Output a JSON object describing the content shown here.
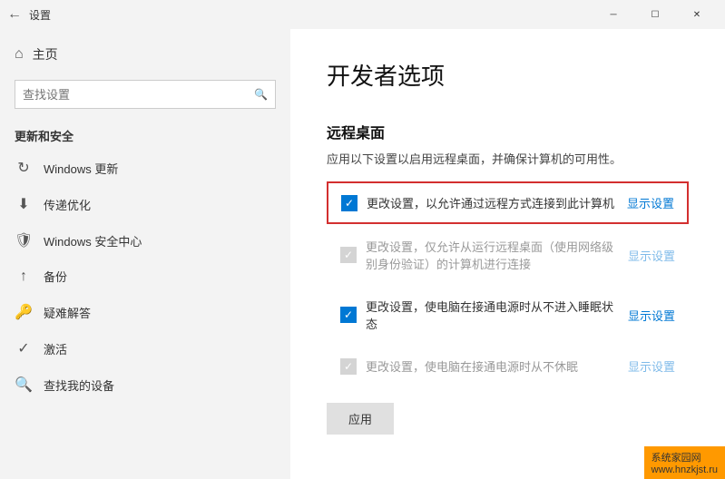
{
  "titlebar": {
    "title": "设置",
    "minimize": "─",
    "maximize": "☐",
    "close": "✕"
  },
  "sidebar": {
    "home_label": "主页",
    "search_placeholder": "查找设置",
    "section_title": "更新和安全",
    "items": [
      {
        "id": "windows-update",
        "label": "Windows 更新",
        "icon": "↻"
      },
      {
        "id": "delivery-opt",
        "label": "传递优化",
        "icon": "⬇"
      },
      {
        "id": "windows-security",
        "label": "Windows 安全中心",
        "icon": "🛡"
      },
      {
        "id": "backup",
        "label": "备份",
        "icon": "↑"
      },
      {
        "id": "troubleshoot",
        "label": "疑难解答",
        "icon": "🔑"
      },
      {
        "id": "activation",
        "label": "激活",
        "icon": "✓"
      },
      {
        "id": "find-device",
        "label": "查找我的设备",
        "icon": "🔍"
      }
    ]
  },
  "content": {
    "title": "开发者选项",
    "remote_desktop_heading": "远程桌面",
    "remote_desktop_desc": "应用以下设置以启用远程桌面，并确保计算机的可用性。",
    "settings": [
      {
        "id": "remote-connect",
        "checked": true,
        "disabled": false,
        "highlighted": true,
        "text": "更改设置，以允许通过远程方式连接到此计算机",
        "link": "显示设置"
      },
      {
        "id": "nla-only",
        "checked": true,
        "disabled": true,
        "highlighted": false,
        "text": "更改设置，仅允许从运行远程桌面（使用网络级别身份验证）的计算机进行连接",
        "link": "显示设置"
      },
      {
        "id": "no-sleep",
        "checked": true,
        "disabled": false,
        "highlighted": false,
        "text": "更改设置，使电脑在接通电源时从不进入睡眠状态",
        "link": "显示设置"
      },
      {
        "id": "no-hibernate",
        "checked": true,
        "disabled": true,
        "highlighted": false,
        "text": "更改设置，使电脑在接通电源时从不休眠",
        "link": "显示设置"
      }
    ],
    "apply_button": "应用"
  },
  "watermark": {
    "line1": "系统家园网",
    "line2": "www.hnzkjst.ru"
  }
}
